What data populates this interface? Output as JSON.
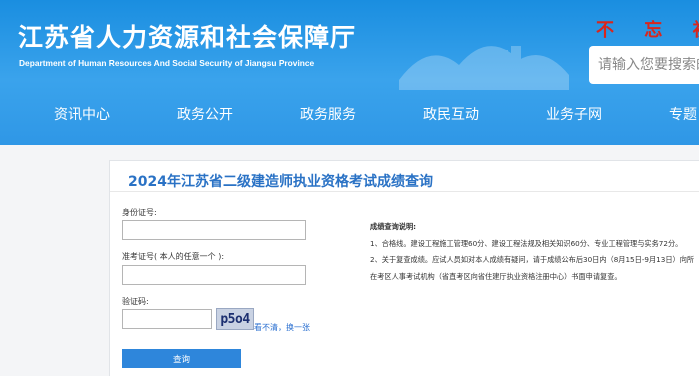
{
  "header": {
    "title": "江苏省人力资源和社会保障厅",
    "subtitle": "Department of Human Resources And Social Security of Jiangsu Province",
    "slogan": "不 忘 初 心",
    "search_placeholder": "请输入您要搜索的"
  },
  "nav": [
    "资讯中心",
    "政务公开",
    "政务服务",
    "政民互动",
    "业务子网",
    "专题"
  ],
  "query": {
    "title": "2024年江苏省二级建造师执业资格考试成绩查询",
    "id_label": "身份证号:",
    "ticket_label": "准考证号( 本人的任意一个 ):",
    "captcha_label": "验证码:",
    "captcha_text": "p5o4",
    "captcha_refresh": "看不清，换一张",
    "submit_label": "查询"
  },
  "notes": {
    "title": "成绩查询说明:",
    "item1": "1、合格线。建设工程施工管理60分、建设工程法规及相关知识60分、专业工程管理与实务72分。",
    "item2": "2、关于复查成绩。应试人员如对本人成绩有疑问，请于成绩公布后30日内（8月15日-9月13日）向所在考区人事考试机构（省直考区向省住建厅执业资格注册中心）书面申请复查。"
  }
}
